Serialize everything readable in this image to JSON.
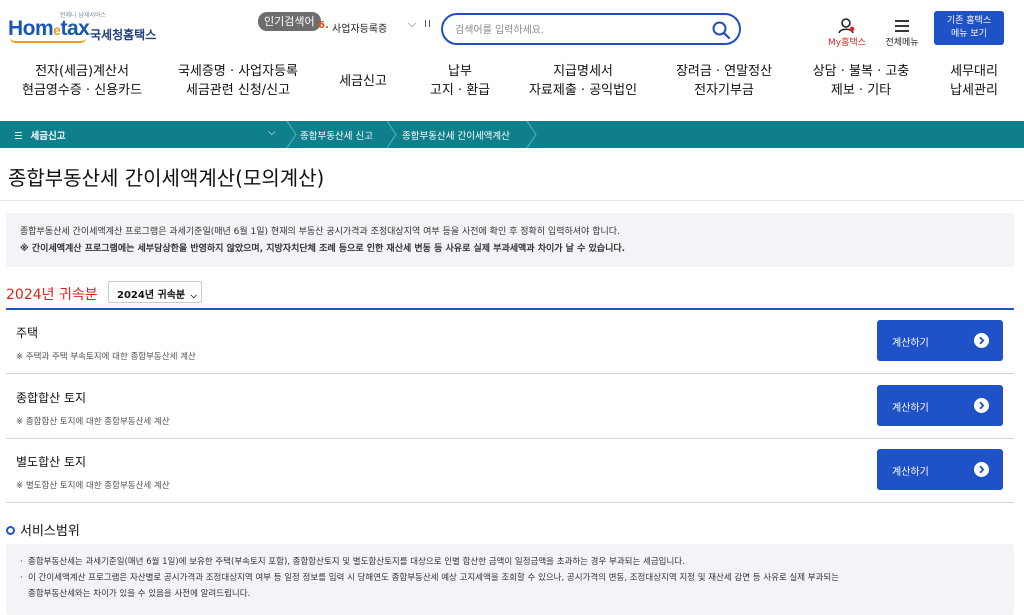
{
  "header": {
    "logo_tag": "언제나 납세서비스",
    "logo_home": "Hom",
    "logo_e": "e",
    "logo_tax": "tax",
    "logo_org": "국세청홈택스",
    "popular_badge": "인기검색어",
    "popular_rank": "6.",
    "popular_word": "사업자등록증",
    "search_placeholder": "검색어를 입력하세요.",
    "my_home": "My홈택스",
    "all_menu": "전체메뉴",
    "old_hometax_line1": "기존 홈택스",
    "old_hometax_line2": "메뉴 보기"
  },
  "nav": [
    {
      "line1": "전자(세금)계산서",
      "line2": "현금영수증 · 신용카드"
    },
    {
      "line1": "국세증명 · 사업자등록",
      "line2": "세금관련 신청/신고"
    },
    {
      "line1": "세금신고",
      "line2": ""
    },
    {
      "line1": "납부",
      "line2": "고지 · 환급"
    },
    {
      "line1": "지급명세서",
      "line2": "자료제출 · 공익법인"
    },
    {
      "line1": "장려금 · 연말정산",
      "line2": "전자기부금"
    },
    {
      "line1": "상담 · 불복 · 고충",
      "line2": "제보 · 기타"
    },
    {
      "line1": "세무대리",
      "line2": "납세관리"
    }
  ],
  "breadcrumb": {
    "menu": "세금신고",
    "items": [
      "종합부동산세 신고",
      "종합부동산세 간이세액계산"
    ]
  },
  "page": {
    "title": "종합부동산세 간이세액계산(모의계산)",
    "notice_line1": "종합부동산세 간이세액계산 프로그램은 과세기준일(매년 6월 1일) 현재의 부동산 공시가격과 조정대상지역 여부 등을 사전에 확인 후 정확히 입력하셔야 합니다.",
    "notice_line2": "※ 간이세액계산 프로그램에는 세부담상한을 반영하지 않았으며, 지방자치단체 조례 등으로 인한 재산세 변동 등 사유로 실제 부과세액과 차이가 날 수 있습니다.",
    "year_label": "2024년 귀속분",
    "year_select": "2024년 귀속분"
  },
  "calc_rows": [
    {
      "name": "주택",
      "desc": "※ 주택과 주택 부속토지에 대한 종합부동산세 계산",
      "button": "계산하기"
    },
    {
      "name": "종합합산 토지",
      "desc": "※ 종합합산 토지에 대한 종합부동산세 계산",
      "button": "계산하기"
    },
    {
      "name": "별도합산 토지",
      "desc": "※ 별도합산 토지에 대한 종합부동산세 계산",
      "button": "계산하기"
    }
  ],
  "service": {
    "title": "서비스범위",
    "line1": "종합부동산세는 과세기준일(매년 6월 1일)에 보유한 주택(부속토지 포함), 종합합산토지 및 별도합산토지를 대상으로 인별 합산한 금액이 일정금액을 초과하는 경우 부과되는 세금입니다.",
    "line2a": "이 간이세액계산 프로그램은 자산별로 공시가격과 조정대상지역 여부 등 일정 정보를 입력 시 당해연도 종합부동산세 예상 고지세액을 조회할 수 있으나, 공시가격의 변동, 조정대상지역 지정 및 재산세 감면 등 사유로 실제 부과되는",
    "line2b": "종합부동산세와는 차이가 있을 수 있음을 사전에 알려드립니다."
  },
  "colors": {
    "brand_blue": "#1f52c7",
    "breadcrumb_teal": "#0f7f8c",
    "accent_red": "#e0221d",
    "logo_orange": "#f39b1b"
  },
  "icons": {
    "search": "search-icon",
    "my_home": "person-icon",
    "all_menu": "hamburger-icon",
    "calc_arrow": "chevron-right-circle-icon"
  }
}
